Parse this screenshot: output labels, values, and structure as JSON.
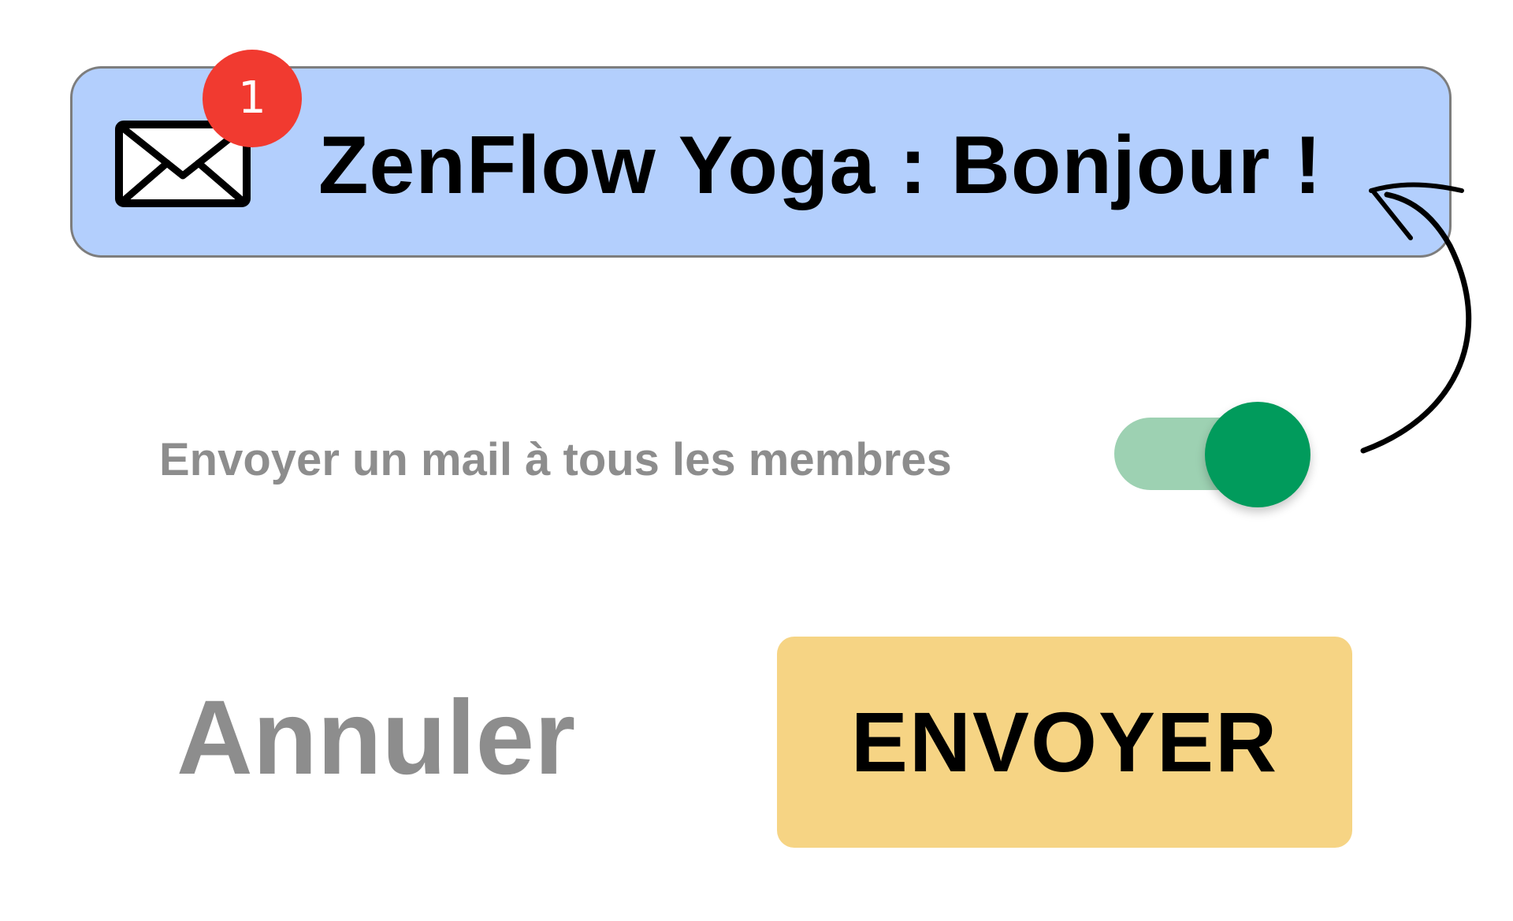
{
  "notification": {
    "title": "ZenFlow Yoga : Bonjour !",
    "badge_count": "1",
    "icon": "envelope-icon"
  },
  "toggle": {
    "label": "Envoyer un mail à tous les membres",
    "state": "on"
  },
  "actions": {
    "cancel_label": "Annuler",
    "send_label": "ENVOYER"
  },
  "colors": {
    "notification_bg": "#b3cffd",
    "badge": "#f13a30",
    "toggle_track": "#9dd1b2",
    "toggle_thumb": "#019b5c",
    "send_button": "#f6d484",
    "muted_text": "#8d8d8d"
  }
}
